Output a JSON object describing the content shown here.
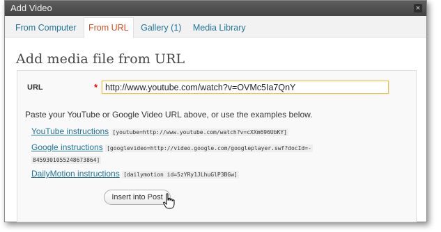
{
  "dialog": {
    "title": "Add Video",
    "close_glyph": "×"
  },
  "tabs": [
    {
      "label": "From Computer",
      "active": false
    },
    {
      "label": "From URL",
      "active": true
    },
    {
      "label": "Gallery (1)",
      "active": false
    },
    {
      "label": "Media Library",
      "active": false
    }
  ],
  "heading": "Add media file from URL",
  "form": {
    "url_label": "URL",
    "required_mark": "*",
    "url_value": "http://www.youtube.com/watch?v=OVMc5Ia7QnY",
    "hint": "Paste your YouTube or Google Video URL above, or use the examples below.",
    "examples": [
      {
        "link": "YouTube instructions",
        "code": "[youtube=http://www.youtube.com/watch?v=cXXm696UbKY]"
      },
      {
        "link": "Google instructions",
        "code": "[googlevideo=http://video.google.com/googleplayer.swf?docId=-",
        "code_cont": "8459301055248673864]"
      },
      {
        "link": "DailyMotion instructions",
        "code": "[dailymotion id=5zYRy1JLhuGlP3BGw]"
      }
    ],
    "insert_button": "Insert into Post"
  },
  "colors": {
    "accent_link": "#21759b",
    "active_tab": "#d54e21",
    "required": "#ff0000"
  },
  "icons": {
    "cursor": "hand-pointer-icon",
    "close": "close-icon"
  }
}
